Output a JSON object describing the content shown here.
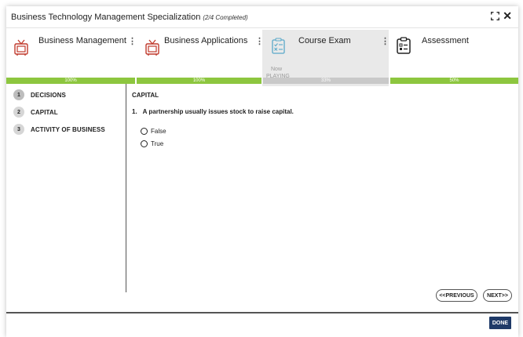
{
  "window": {
    "title": "Business Technology Management Specialization",
    "completion": "(2/4 Completed)"
  },
  "modules": [
    {
      "label": "Business Management",
      "progress": "100%",
      "progress_value": 100,
      "icon": "tv-icon"
    },
    {
      "label": "Business Applications",
      "progress": "100%",
      "progress_value": 100,
      "icon": "tv-icon"
    },
    {
      "label": "Course Exam",
      "progress": "33%",
      "progress_value": 33,
      "icon": "quiz-icon",
      "status_line1": "Now",
      "status_line2": "PLAYING"
    },
    {
      "label": "Assessment",
      "progress": "50%",
      "progress_value": 50,
      "icon": "clipboard-icon"
    }
  ],
  "sidebar": {
    "items": [
      {
        "num": "1",
        "label": "DECISIONS"
      },
      {
        "num": "2",
        "label": "CAPITAL"
      },
      {
        "num": "3",
        "label": "ACTIVITY OF BUSINESS"
      }
    ]
  },
  "content": {
    "section_title": "CAPITAL",
    "question_number": "1.",
    "question_text": "A partnership usually issues stock to raise capital.",
    "options": [
      "False",
      "True"
    ]
  },
  "buttons": {
    "previous": "<<PREVIOUS",
    "next": "NEXT>>",
    "done": "DONE"
  },
  "colors": {
    "progress_green": "#8dc63f",
    "progress_grey": "#c9c9c9",
    "done_navy": "#1f3a68",
    "icon_teal": "#5aa9c9",
    "icon_red": "#c0392b"
  }
}
